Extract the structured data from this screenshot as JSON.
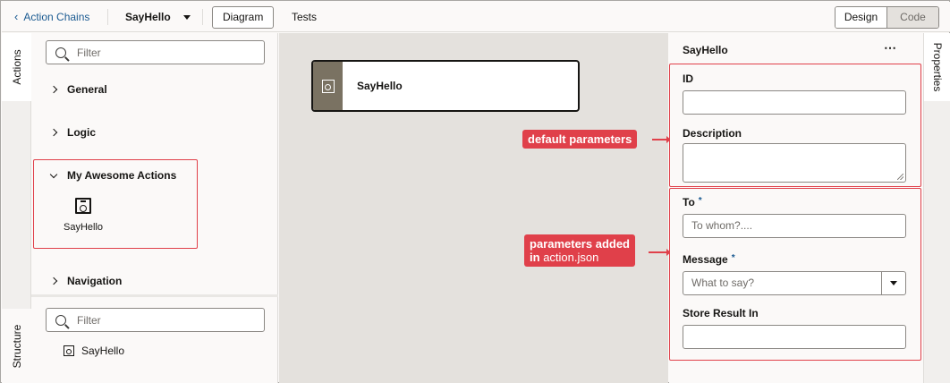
{
  "topbar": {
    "back_label": "Action Chains",
    "chain_name": "SayHello",
    "tabs": [
      {
        "label": "Diagram"
      },
      {
        "label": "Tests"
      }
    ],
    "mode": {
      "design": "Design",
      "code": "Code"
    }
  },
  "left_tabs": {
    "actions": "Actions",
    "structure": "Structure"
  },
  "actions_panel": {
    "filter_placeholder": "Filter",
    "categories": [
      {
        "label": "General"
      },
      {
        "label": "Logic"
      },
      {
        "label": "My Awesome Actions"
      },
      {
        "label": "Navigation"
      }
    ],
    "custom_action": {
      "label": "SayHello",
      "icon": "custom-action-icon"
    }
  },
  "structure_panel": {
    "filter_placeholder": "Filter",
    "items": [
      {
        "label": "SayHello"
      }
    ]
  },
  "canvas": {
    "node": {
      "label": "SayHello",
      "icon": "custom-action-icon"
    }
  },
  "callouts": {
    "default_params": "default parameters",
    "added_params_line1": "parameters added",
    "added_params_line2_bold": "in",
    "added_params_line2_light": "action.json"
  },
  "properties": {
    "title": "SayHello",
    "more": "⋯",
    "tab_label": "Properties",
    "fields": {
      "id": {
        "label": "ID",
        "value": ""
      },
      "description": {
        "label": "Description",
        "value": ""
      },
      "to": {
        "label": "To",
        "required": "*",
        "placeholder": "To whom?...."
      },
      "message": {
        "label": "Message",
        "required": "*",
        "placeholder": "What to say?"
      },
      "store": {
        "label": "Store Result In",
        "value": ""
      }
    }
  },
  "colors": {
    "accent": "#1a5a91",
    "highlight": "#e0404a",
    "node_side": "#7a7262"
  }
}
